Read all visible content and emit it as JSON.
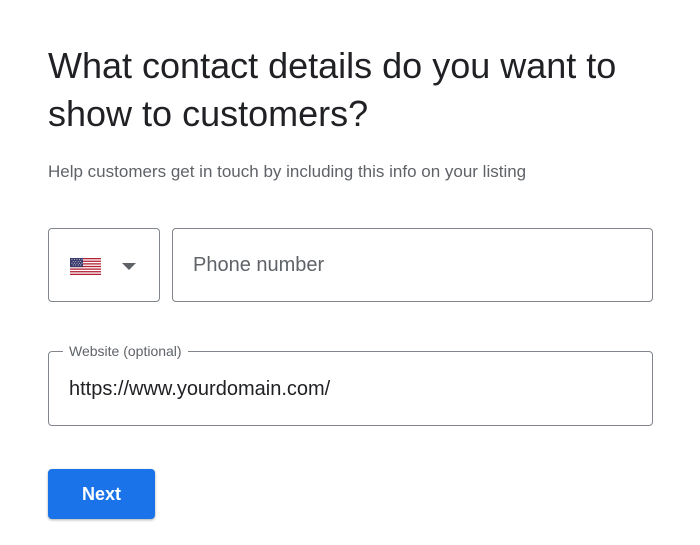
{
  "heading": "What contact details do you want to show to customers?",
  "subheading": "Help customers get in touch by including this info on your listing",
  "country_select": {
    "flag_icon": "us-flag-icon",
    "caret_icon": "caret-down-icon"
  },
  "phone": {
    "placeholder": "Phone number",
    "value": ""
  },
  "website": {
    "label": "Website (optional)",
    "value": "https://www.yourdomain.com/"
  },
  "next_button": {
    "label": "Next"
  },
  "colors": {
    "primary": "#1a73e8",
    "text": "#202124",
    "secondary_text": "#5f6368",
    "border": "#80868b"
  }
}
